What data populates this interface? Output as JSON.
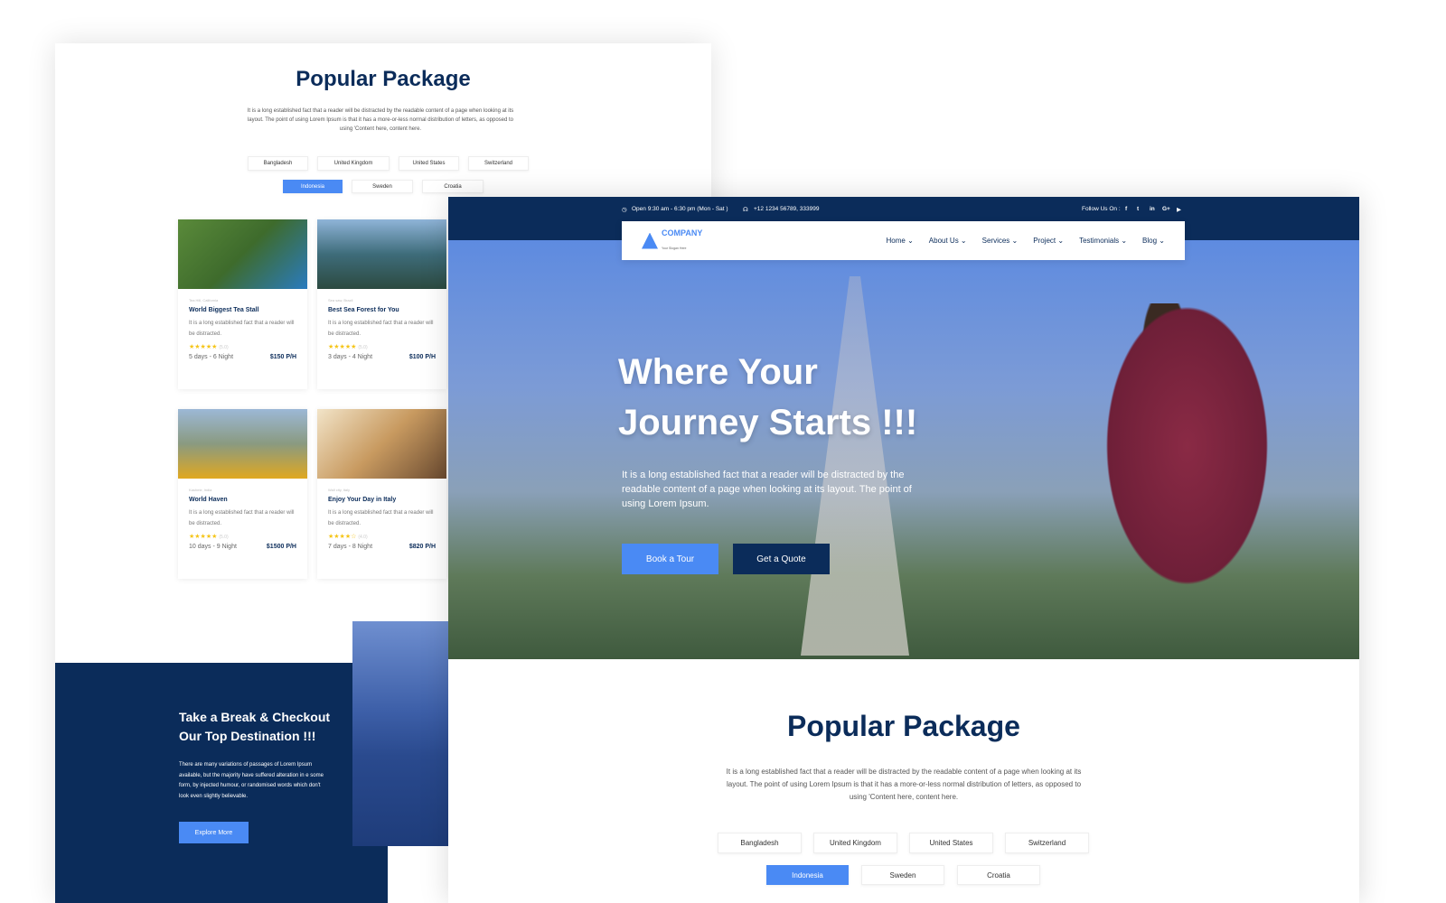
{
  "package": {
    "title": "Popular Package",
    "intro": "It is a long established fact that a reader will be distracted by the readable content of a page when looking at its layout. The point of using Lorem Ipsum is that it has a more-or-less normal distribution of letters, as opposed to using 'Content here, content here.",
    "tabs_row1": [
      "Bangladesh",
      "United Kingdom",
      "United States",
      "Switzerland"
    ],
    "tabs_row2": [
      "Indonesia",
      "Sweden",
      "Croatia"
    ],
    "active_tab": "Indonesia",
    "cards": [
      {
        "location": "Tea Hill, California",
        "title": "World Biggest Tea Stall",
        "desc": "It is a long established fact that a reader will be distracted.",
        "stars": "★★★★★",
        "rating": "(5.0)",
        "duration": "5 days - 6 Night",
        "price": "$150 P/H"
      },
      {
        "location": "Sea saw, Brazil",
        "title": "Best Sea Forest for You",
        "desc": "It is a long established fact that a reader will be distracted.",
        "stars": "★★★★★",
        "rating": "(5.0)",
        "duration": "3 days - 4 Night",
        "price": "$100 P/H"
      },
      {
        "location": "Kashmir, India",
        "title": "World Haven",
        "desc": "It is a long established fact that a reader will be distracted.",
        "stars": "★★★★★",
        "rating": "(5.0)",
        "duration": "10 days - 9 Night",
        "price": "$1500 P/H"
      },
      {
        "location": "Wall city, Italy",
        "title": "Enjoy Your Day in Italy",
        "desc": "It is a long established fact that a reader will be distracted.",
        "stars": "★★★★☆",
        "rating": "(4.0)",
        "duration": "7 days - 8 Night",
        "price": "$820 P/H"
      }
    ]
  },
  "destination": {
    "title1": "Take a Break & Checkout",
    "title2": "Our Top Destination !!!",
    "text": "There are many variations of passages of Lorem Ipsum available, but the majority have suffered alteration in e some form, by injected humour, or randomised words which don't look even slightly believable.",
    "button": "Explore More"
  },
  "topbar": {
    "hours": "Open 9:30 am - 6:30 pm (Mon - Sat )",
    "phone": "+12 1234 56789, 333999",
    "follow": "Follow Us On :",
    "social": [
      "f",
      "t",
      "in",
      "G+",
      "▶"
    ]
  },
  "logo": {
    "name": "COMPANY",
    "slogan": "Your Slogan Here"
  },
  "menu": [
    "Home",
    "About Us",
    "Services",
    "Project",
    "Testimonials",
    "Blog"
  ],
  "hero": {
    "line1": "Where Your",
    "line2": "Journey Starts !!!",
    "text": "It is a long established fact that a reader will be distracted by the readable content of a page when looking at its layout. The point of using Lorem Ipsum.",
    "book": "Book a Tour",
    "quote": "Get a Quote"
  },
  "colors": {
    "navy": "#0b2c5a",
    "accent": "#4a8af4",
    "star": "#f5c518"
  }
}
